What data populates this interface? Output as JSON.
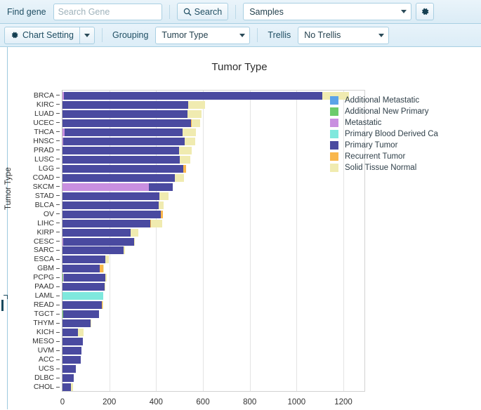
{
  "toolbar_top": {
    "find_gene_label": "Find gene",
    "search_input_placeholder": "Search Gene",
    "search_input_value": "",
    "search_button_label": "Search",
    "search_icon": "search-icon",
    "dataset_select_value": "Samples",
    "settings_icon": "gear-icon"
  },
  "toolbar_second": {
    "chart_setting_label": "Chart Setting",
    "chart_setting_icon": "gear-icon",
    "split_caret_icon": "chevron-down-icon",
    "grouping_label": "Grouping",
    "grouping_select_value": "Tumor Type",
    "trellis_label": "Trellis",
    "trellis_select_value": "No Trellis"
  },
  "chart_data": {
    "type": "bar",
    "orientation": "horizontal",
    "stacked": true,
    "title": "Tumor Type",
    "xlabel": "",
    "ylabel": "Tumor Type",
    "xlim": [
      0,
      1290
    ],
    "xticks": [
      0,
      200,
      400,
      600,
      800,
      1000,
      1200
    ],
    "grid": "vertical",
    "legend_position": "right",
    "legend_clipped": true,
    "series": [
      {
        "name": "Additional Metastatic",
        "color": "#5ba3e8"
      },
      {
        "name": "Additional New Primary",
        "color": "#6bcb6b"
      },
      {
        "name": "Metastatic",
        "color": "#c98fe0"
      },
      {
        "name": "Primary Blood Derived Ca",
        "color": "#7fe8dd"
      },
      {
        "name": "Primary Tumor",
        "color": "#4a4aa0"
      },
      {
        "name": "Recurrent Tumor",
        "color": "#f9b74c"
      },
      {
        "name": "Solid Tissue Normal",
        "color": "#f0ebb0"
      }
    ],
    "categories": [
      "BRCA",
      "KIRC",
      "LUAD",
      "UCEC",
      "THCA",
      "HNSC",
      "PRAD",
      "LUSC",
      "LGG",
      "COAD",
      "SKCM",
      "STAD",
      "BLCA",
      "OV",
      "LIHC",
      "KIRP",
      "CESC",
      "SARC",
      "ESCA",
      "GBM",
      "PCPG",
      "PAAD",
      "LAML",
      "READ",
      "TGCT",
      "THYM",
      "KICH",
      "MESO",
      "UVM",
      "ACC",
      "UCS",
      "DLBC",
      "CHOL"
    ],
    "rows": [
      {
        "category": "BRCA",
        "values": {
          "Additional Metastatic": 0,
          "Additional New Primary": 0,
          "Metastatic": 7,
          "Primary Blood Derived Ca": 0,
          "Primary Tumor": 1102,
          "Recurrent Tumor": 0,
          "Solid Tissue Normal": 114
        },
        "total": 1223
      },
      {
        "category": "KIRC",
        "values": {
          "Additional Metastatic": 0,
          "Additional New Primary": 0,
          "Metastatic": 0,
          "Primary Blood Derived Ca": 0,
          "Primary Tumor": 538,
          "Recurrent Tumor": 0,
          "Solid Tissue Normal": 72
        },
        "total": 610
      },
      {
        "category": "LUAD",
        "values": {
          "Additional Metastatic": 0,
          "Additional New Primary": 0,
          "Metastatic": 0,
          "Primary Blood Derived Ca": 0,
          "Primary Tumor": 533,
          "Recurrent Tumor": 2,
          "Solid Tissue Normal": 59
        },
        "total": 594
      },
      {
        "category": "UCEC",
        "values": {
          "Additional Metastatic": 0,
          "Additional New Primary": 0,
          "Metastatic": 0,
          "Primary Blood Derived Ca": 0,
          "Primary Tumor": 548,
          "Recurrent Tumor": 4,
          "Solid Tissue Normal": 35
        },
        "total": 587
      },
      {
        "category": "THCA",
        "values": {
          "Additional Metastatic": 0,
          "Additional New Primary": 0,
          "Metastatic": 8,
          "Primary Blood Derived Ca": 0,
          "Primary Tumor": 505,
          "Recurrent Tumor": 0,
          "Solid Tissue Normal": 58
        },
        "total": 571
      },
      {
        "category": "HNSC",
        "values": {
          "Additional Metastatic": 0,
          "Additional New Primary": 0,
          "Metastatic": 2,
          "Primary Blood Derived Ca": 0,
          "Primary Tumor": 520,
          "Recurrent Tumor": 0,
          "Solid Tissue Normal": 44
        },
        "total": 566
      },
      {
        "category": "PRAD",
        "values": {
          "Additional Metastatic": 0,
          "Additional New Primary": 0,
          "Metastatic": 1,
          "Primary Blood Derived Ca": 0,
          "Primary Tumor": 498,
          "Recurrent Tumor": 0,
          "Solid Tissue Normal": 52
        },
        "total": 551
      },
      {
        "category": "LUSC",
        "values": {
          "Additional Metastatic": 0,
          "Additional New Primary": 0,
          "Metastatic": 0,
          "Primary Blood Derived Ca": 0,
          "Primary Tumor": 502,
          "Recurrent Tumor": 0,
          "Solid Tissue Normal": 45
        },
        "total": 547
      },
      {
        "category": "LGG",
        "values": {
          "Additional Metastatic": 0,
          "Additional New Primary": 0,
          "Metastatic": 0,
          "Primary Blood Derived Ca": 0,
          "Primary Tumor": 516,
          "Recurrent Tumor": 13,
          "Solid Tissue Normal": 0
        },
        "total": 529
      },
      {
        "category": "COAD",
        "values": {
          "Additional Metastatic": 0,
          "Additional New Primary": 0,
          "Metastatic": 1,
          "Primary Blood Derived Ca": 0,
          "Primary Tumor": 478,
          "Recurrent Tumor": 0,
          "Solid Tissue Normal": 41
        },
        "total": 520
      },
      {
        "category": "SKCM",
        "values": {
          "Additional Metastatic": 1,
          "Additional New Primary": 0,
          "Metastatic": 368,
          "Primary Blood Derived Ca": 0,
          "Primary Tumor": 103,
          "Recurrent Tumor": 0,
          "Solid Tissue Normal": 0
        },
        "total": 472
      },
      {
        "category": "STAD",
        "values": {
          "Additional Metastatic": 0,
          "Additional New Primary": 0,
          "Metastatic": 0,
          "Primary Blood Derived Ca": 0,
          "Primary Tumor": 415,
          "Recurrent Tumor": 0,
          "Solid Tissue Normal": 37
        },
        "total": 452
      },
      {
        "category": "BLCA",
        "values": {
          "Additional Metastatic": 0,
          "Additional New Primary": 0,
          "Metastatic": 0,
          "Primary Blood Derived Ca": 0,
          "Primary Tumor": 412,
          "Recurrent Tumor": 0,
          "Solid Tissue Normal": 19
        },
        "total": 431
      },
      {
        "category": "OV",
        "values": {
          "Additional Metastatic": 0,
          "Additional New Primary": 0,
          "Metastatic": 0,
          "Primary Blood Derived Ca": 0,
          "Primary Tumor": 420,
          "Recurrent Tumor": 8,
          "Solid Tissue Normal": 0
        },
        "total": 428
      },
      {
        "category": "LIHC",
        "values": {
          "Additional Metastatic": 0,
          "Additional New Primary": 0,
          "Metastatic": 0,
          "Primary Blood Derived Ca": 0,
          "Primary Tumor": 374,
          "Recurrent Tumor": 3,
          "Solid Tissue Normal": 50
        },
        "total": 427
      },
      {
        "category": "KIRP",
        "values": {
          "Additional Metastatic": 0,
          "Additional New Primary": 0,
          "Metastatic": 0,
          "Primary Blood Derived Ca": 0,
          "Primary Tumor": 291,
          "Recurrent Tumor": 0,
          "Solid Tissue Normal": 32
        },
        "total": 323
      },
      {
        "category": "CESC",
        "values": {
          "Additional Metastatic": 0,
          "Additional New Primary": 0,
          "Metastatic": 2,
          "Primary Blood Derived Ca": 0,
          "Primary Tumor": 304,
          "Recurrent Tumor": 0,
          "Solid Tissue Normal": 3
        },
        "total": 309
      },
      {
        "category": "SARC",
        "values": {
          "Additional Metastatic": 0,
          "Additional New Primary": 0,
          "Metastatic": 1,
          "Primary Blood Derived Ca": 0,
          "Primary Tumor": 259,
          "Recurrent Tumor": 2,
          "Solid Tissue Normal": 2
        },
        "total": 264
      },
      {
        "category": "ESCA",
        "values": {
          "Additional Metastatic": 0,
          "Additional New Primary": 0,
          "Metastatic": 0,
          "Primary Blood Derived Ca": 0,
          "Primary Tumor": 184,
          "Recurrent Tumor": 0,
          "Solid Tissue Normal": 13
        },
        "total": 197
      },
      {
        "category": "GBM",
        "values": {
          "Additional Metastatic": 0,
          "Additional New Primary": 0,
          "Metastatic": 0,
          "Primary Blood Derived Ca": 0,
          "Primary Tumor": 160,
          "Recurrent Tumor": 13,
          "Solid Tissue Normal": 5
        },
        "total": 178
      },
      {
        "category": "PCPG",
        "values": {
          "Additional Metastatic": 0,
          "Additional New Primary": 3,
          "Metastatic": 2,
          "Primary Blood Derived Ca": 0,
          "Primary Tumor": 179,
          "Recurrent Tumor": 0,
          "Solid Tissue Normal": 3
        },
        "total": 187
      },
      {
        "category": "PAAD",
        "values": {
          "Additional Metastatic": 0,
          "Additional New Primary": 0,
          "Metastatic": 1,
          "Primary Blood Derived Ca": 0,
          "Primary Tumor": 178,
          "Recurrent Tumor": 0,
          "Solid Tissue Normal": 4
        },
        "total": 183
      },
      {
        "category": "LAML",
        "values": {
          "Additional Metastatic": 0,
          "Additional New Primary": 0,
          "Metastatic": 0,
          "Primary Blood Derived Ca": 173,
          "Primary Tumor": 0,
          "Recurrent Tumor": 0,
          "Solid Tissue Normal": 0
        },
        "total": 173
      },
      {
        "category": "READ",
        "values": {
          "Additional Metastatic": 0,
          "Additional New Primary": 0,
          "Metastatic": 1,
          "Primary Blood Derived Ca": 0,
          "Primary Tumor": 166,
          "Recurrent Tumor": 3,
          "Solid Tissue Normal": 4
        },
        "total": 174
      },
      {
        "category": "TGCT",
        "values": {
          "Additional Metastatic": 0,
          "Additional New Primary": 4,
          "Metastatic": 0,
          "Primary Blood Derived Ca": 0,
          "Primary Tumor": 152,
          "Recurrent Tumor": 0,
          "Solid Tissue Normal": 0
        },
        "total": 156
      },
      {
        "category": "THYM",
        "values": {
          "Additional Metastatic": 0,
          "Additional New Primary": 0,
          "Metastatic": 0,
          "Primary Blood Derived Ca": 0,
          "Primary Tumor": 120,
          "Recurrent Tumor": 0,
          "Solid Tissue Normal": 2
        },
        "total": 122
      },
      {
        "category": "KICH",
        "values": {
          "Additional Metastatic": 0,
          "Additional New Primary": 0,
          "Metastatic": 0,
          "Primary Blood Derived Ca": 0,
          "Primary Tumor": 66,
          "Recurrent Tumor": 0,
          "Solid Tissue Normal": 25
        },
        "total": 91
      },
      {
        "category": "MESO",
        "values": {
          "Additional Metastatic": 0,
          "Additional New Primary": 0,
          "Metastatic": 0,
          "Primary Blood Derived Ca": 0,
          "Primary Tumor": 87,
          "Recurrent Tumor": 0,
          "Solid Tissue Normal": 0
        },
        "total": 87
      },
      {
        "category": "UVM",
        "values": {
          "Additional Metastatic": 0,
          "Additional New Primary": 0,
          "Metastatic": 0,
          "Primary Blood Derived Ca": 0,
          "Primary Tumor": 80,
          "Recurrent Tumor": 0,
          "Solid Tissue Normal": 0
        },
        "total": 80
      },
      {
        "category": "ACC",
        "values": {
          "Additional Metastatic": 0,
          "Additional New Primary": 0,
          "Metastatic": 0,
          "Primary Blood Derived Ca": 0,
          "Primary Tumor": 79,
          "Recurrent Tumor": 0,
          "Solid Tissue Normal": 0
        },
        "total": 79
      },
      {
        "category": "UCS",
        "values": {
          "Additional Metastatic": 0,
          "Additional New Primary": 0,
          "Metastatic": 0,
          "Primary Blood Derived Ca": 0,
          "Primary Tumor": 57,
          "Recurrent Tumor": 0,
          "Solid Tissue Normal": 0
        },
        "total": 57
      },
      {
        "category": "DLBC",
        "values": {
          "Additional Metastatic": 0,
          "Additional New Primary": 0,
          "Metastatic": 0,
          "Primary Blood Derived Ca": 0,
          "Primary Tumor": 48,
          "Recurrent Tumor": 0,
          "Solid Tissue Normal": 0
        },
        "total": 48
      },
      {
        "category": "CHOL",
        "values": {
          "Additional Metastatic": 0,
          "Additional New Primary": 0,
          "Metastatic": 0,
          "Primary Blood Derived Ca": 0,
          "Primary Tumor": 36,
          "Recurrent Tumor": 0,
          "Solid Tissue Normal": 9
        },
        "total": 45
      }
    ]
  }
}
